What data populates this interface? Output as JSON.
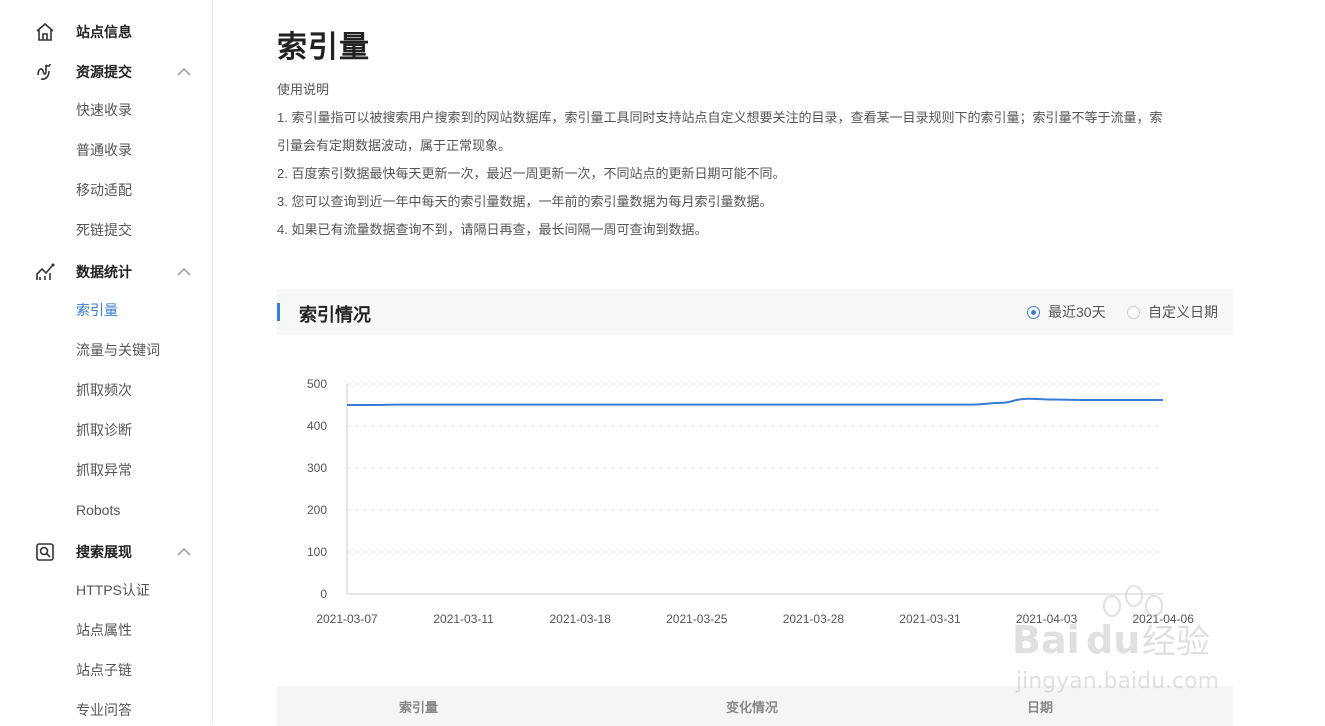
{
  "sidebar": {
    "sections": [
      {
        "label": "站点信息",
        "icon": "home-icon",
        "items": []
      },
      {
        "label": "资源提交",
        "icon": "submit-icon",
        "items": [
          "快速收录",
          "普通收录",
          "移动适配",
          "死链提交"
        ]
      },
      {
        "label": "数据统计",
        "icon": "stats-icon",
        "items": [
          "索引量",
          "流量与关键词",
          "抓取频次",
          "抓取诊断",
          "抓取异常",
          "Robots"
        ]
      },
      {
        "label": "搜索展现",
        "icon": "search-display-icon",
        "items": [
          "HTTPS认证",
          "站点属性",
          "站点子链",
          "专业问答"
        ]
      }
    ],
    "active_item": "索引量"
  },
  "main": {
    "title": "索引量",
    "description": [
      "使用说明",
      "1. 索引量指可以被搜索用户搜索到的网站数据库，索引量工具同时支持站点自定义想要关注的目录，查看某一目录规则下的索引量；索引量不等于流量，索",
      "引量会有定期数据波动，属于正常现象。",
      "2. 百度索引数据最快每天更新一次，最迟一周更新一次，不同站点的更新日期可能不同。",
      "3. 您可以查询到近一年中每天的索引量数据，一年前的索引量数据为每月索引量数据。",
      "4. 如果已有流量数据查询不到，请隔日再查，最长间隔一周可查询到数据。"
    ],
    "panel": {
      "title": "索引情况",
      "radio_recent": "最近30天",
      "radio_custom": "自定义日期",
      "selected": "最近30天"
    },
    "table": {
      "headers": [
        "索引量",
        "变化情况",
        "日期"
      ]
    }
  },
  "chart_data": {
    "type": "line",
    "x_ticks": [
      "2021-03-07",
      "2021-03-11",
      "2021-03-18",
      "2021-03-25",
      "2021-03-28",
      "2021-03-31",
      "2021-04-03",
      "2021-04-06"
    ],
    "y_ticks": [
      0,
      100,
      200,
      300,
      400,
      500
    ],
    "ylim": [
      0,
      500
    ],
    "grid": true,
    "series": [
      {
        "color": "#3a7bd5",
        "values": [
          450,
          450,
          451,
          451,
          451,
          451,
          451,
          451,
          451,
          451,
          451,
          451,
          451,
          451,
          451,
          451,
          451,
          451,
          451,
          451,
          451,
          451,
          451,
          451,
          455,
          465,
          463,
          462,
          462,
          462,
          462
        ]
      }
    ],
    "x_first": "2021-03-07",
    "x_last": "2021-04-06"
  },
  "watermark": {
    "brand": "Bai",
    "brand2": "du",
    "suffix": "经验",
    "url": "jingyan.baidu.com"
  }
}
